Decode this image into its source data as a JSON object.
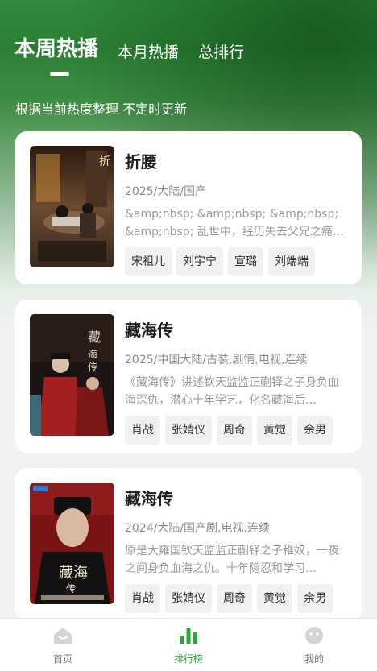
{
  "tabs": [
    {
      "label": "本周热播"
    },
    {
      "label": "本月热播"
    },
    {
      "label": "总排行"
    }
  ],
  "subtitle": "根据当前热度整理 不定时更新",
  "items": [
    {
      "title": "折腰",
      "meta": "2025/大陆/国产",
      "desc": "&amp;nbsp; &amp;nbsp; &amp;nbsp; &amp;nbsp; 乱世中，经历失去父兄之痛…",
      "cast": [
        "宋祖儿",
        "刘宇宁",
        "宣璐",
        "刘端端"
      ]
    },
    {
      "title": "藏海传",
      "meta": "2025/中国大陆/古装,剧情,电视,连续",
      "desc": "《藏海传》讲述钦天监监正蒯铎之子身负血海深仇，潜心十年学艺，化名藏海后…",
      "cast": [
        "肖战",
        "张婧仪",
        "周奇",
        "黄觉",
        "余男"
      ]
    },
    {
      "title": "藏海传",
      "meta": "2024/大陆/国产剧,电视,连续",
      "desc": "原是大雍国钦天监监正蒯铎之子稚奴，一夜之间身负血海之仇。十年隐忍和学习…",
      "cast": [
        "肖战",
        "张婧仪",
        "周奇",
        "黄觉",
        "余男"
      ]
    }
  ],
  "nav": [
    {
      "label": "首页",
      "icon": "home-icon"
    },
    {
      "label": "排行榜",
      "icon": "chart-icon"
    },
    {
      "label": "我的",
      "icon": "profile-icon"
    }
  ],
  "colors": {
    "accent": "#2aa83b",
    "header_green": "#2b7f34"
  }
}
